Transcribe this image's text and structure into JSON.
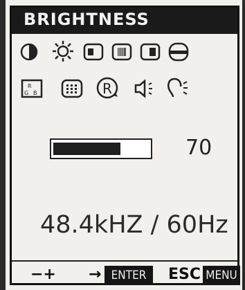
{
  "menu": {
    "title": "BRIGHTNESS"
  },
  "icons": [
    "contrast-icon",
    "brightness-icon",
    "position-icon",
    "size-icon",
    "phase-icon",
    "exit-icon",
    "color-icon",
    "sharpness-icon",
    "reset-icon",
    "volume-icon",
    "input-icon"
  ],
  "brightness": {
    "level": 0.7,
    "value": "70"
  },
  "signal": {
    "text": "48.4kHZ / 60Hz"
  },
  "footer": {
    "adjust": "−+",
    "arrow": "→",
    "enter": "ENTER",
    "esc": "ESC",
    "menu": "MENU"
  }
}
